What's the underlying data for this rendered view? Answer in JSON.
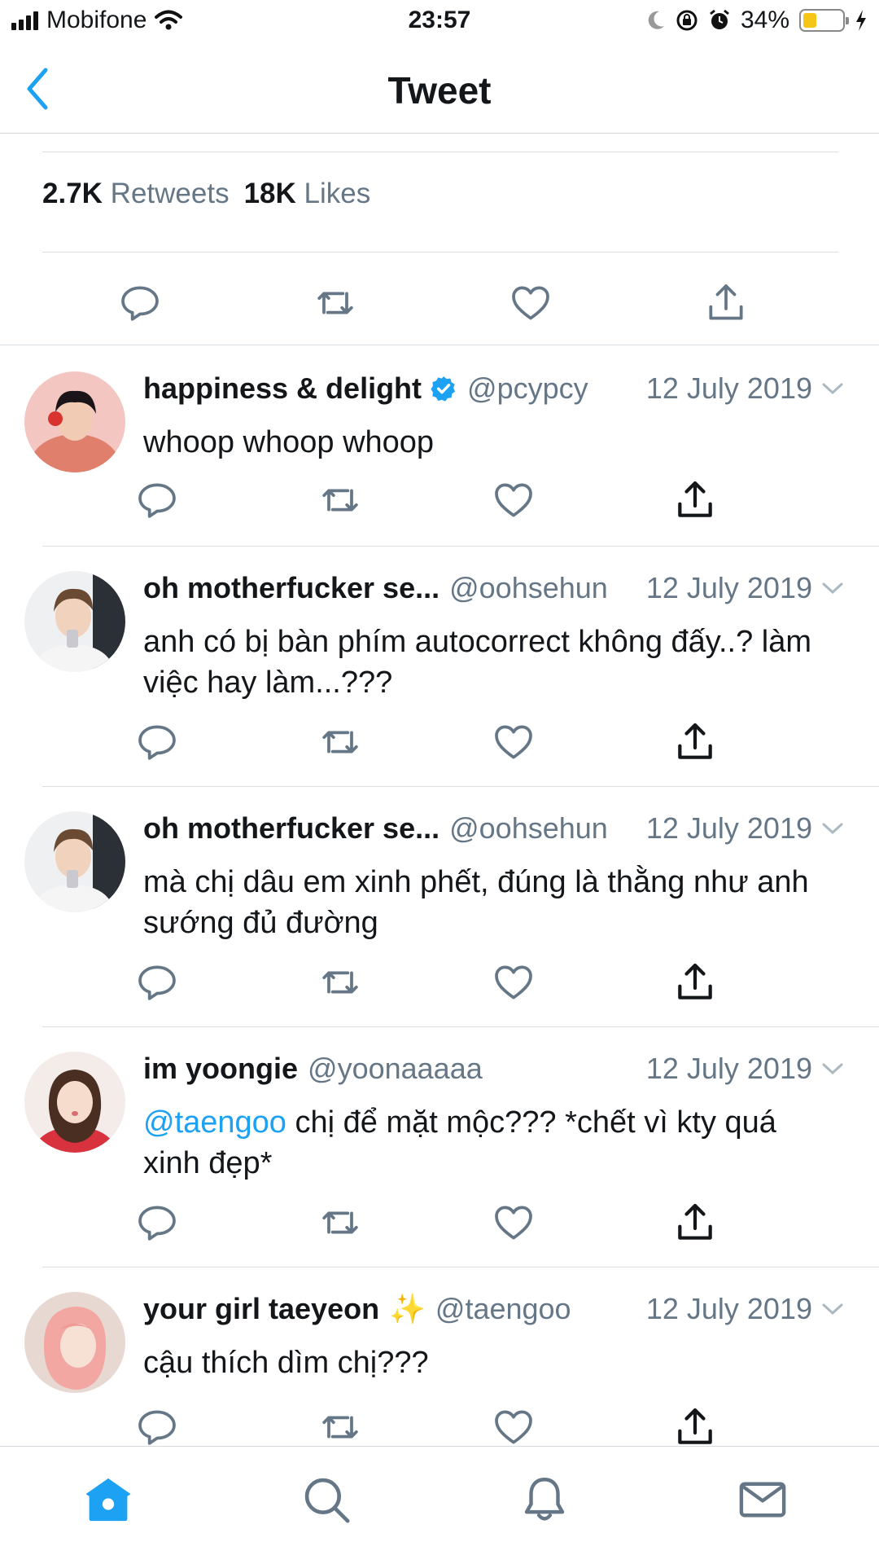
{
  "status_bar": {
    "carrier": "Mobifone",
    "time": "23:57",
    "battery_percent_text": "34%",
    "battery_level": 0.34,
    "battery_color": "#f5c518"
  },
  "nav": {
    "title": "Tweet",
    "back_icon": "chevron-left-icon"
  },
  "stats": {
    "retweets_count": "2.7K",
    "retweets_label": "Retweets",
    "likes_count": "18K",
    "likes_label": "Likes"
  },
  "colors": {
    "accent": "#1da1f2",
    "secondary_text": "#657786",
    "icon_gray": "#657786"
  },
  "replies": [
    {
      "name": "happiness & delight",
      "verified": true,
      "handle": "@pcypcy",
      "date": "12 July 2019",
      "mention": "",
      "text": "whoop whoop whoop"
    },
    {
      "name": "oh motherfucker se...",
      "handle": "@oohsehun",
      "date": "12 July 2019",
      "mention": "",
      "text": "anh có bị bàn phím autocorrect không đấy..? làm việc hay làm...???"
    },
    {
      "name": "oh motherfucker se...",
      "handle": "@oohsehun",
      "date": "12 July 2019",
      "mention": "",
      "text": "mà chị dâu em xinh phết, đúng là thằng như anh sướng đủ đường"
    },
    {
      "name": "im yoongie",
      "handle": "@yoonaaaaa",
      "date": "12 July 2019",
      "mention": "@taengoo",
      "text": " chị để mặt mộc??? *chết vì kty quá xinh đẹp*"
    },
    {
      "name": "your girl taeyeon",
      "emoji": "✨",
      "handle": "@taengoo",
      "date": "12 July 2019",
      "mention": "",
      "text": "cậu thích dìm chị???"
    }
  ],
  "tab_bar": {
    "items": [
      "home-icon",
      "search-icon",
      "notifications-icon",
      "messages-icon"
    ],
    "active": "home-icon"
  }
}
